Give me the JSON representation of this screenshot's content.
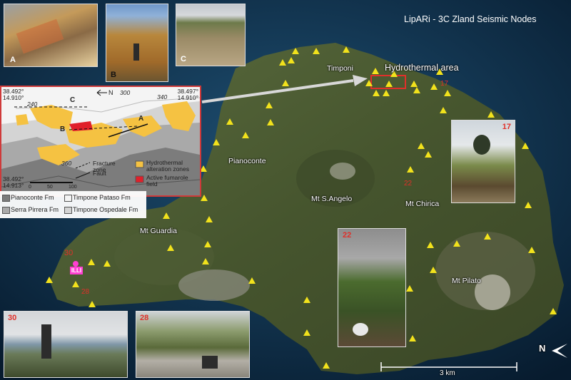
{
  "title": "LipARi - 3C Zland Seismic Nodes",
  "place_names": {
    "timponi": "Timponi",
    "hydrothermal_area": "Hydrothermal area",
    "pianoconte": "Pianoconte",
    "mt_sangelo": "Mt S.Angelo",
    "mt_chirica": "Mt Chirica",
    "mt_guardia": "Mt Guardia",
    "mt_pilato": "Mt Pilato"
  },
  "node_labels": {
    "n17": "17",
    "n22": "22",
    "n28": "28",
    "n30": "30",
    "station": "ILLI"
  },
  "photos": {
    "a": "A",
    "b": "B",
    "c": "C",
    "p17": "17",
    "p22": "22",
    "p30": "30",
    "p28": "28"
  },
  "geo_map": {
    "nw_lat": "38.492°",
    "nw_lon": "14.910°",
    "ne_lat": "38.497°",
    "ne_lon": "14.910°",
    "sw_lat": "38.492°",
    "sw_lon": "14.913°",
    "contour_300": "300",
    "contour_340": "340",
    "contour_360": "360",
    "contour_240": "240",
    "section_a": "A",
    "section_b": "B",
    "section_c": "C",
    "north": "N",
    "scale_0": "0",
    "scale_50": "50",
    "scale_100": "100",
    "scale_m": "m",
    "legend_hydro": "Hydrothermal alteration zones",
    "legend_fumarole": "Active fumarole field",
    "legend_fracture": "Fracture zone",
    "legend_fault": "Fault"
  },
  "formations": {
    "pianoconte": "Pianoconte Fm",
    "pataso": "Timpone Pataso Fm",
    "pirrera": "Serra Pirrera Fm",
    "ospedale": "Timpone Ospedale Fm"
  },
  "scale_bar": "3 km",
  "north_arrow": "N",
  "colors": {
    "node": "#f2e21c",
    "alteration": "#f5c242",
    "fumarole": "#e0202a",
    "frame_red": "#cf3a3a",
    "sea": "#0d2b44",
    "land": "#4a5a3a"
  }
}
